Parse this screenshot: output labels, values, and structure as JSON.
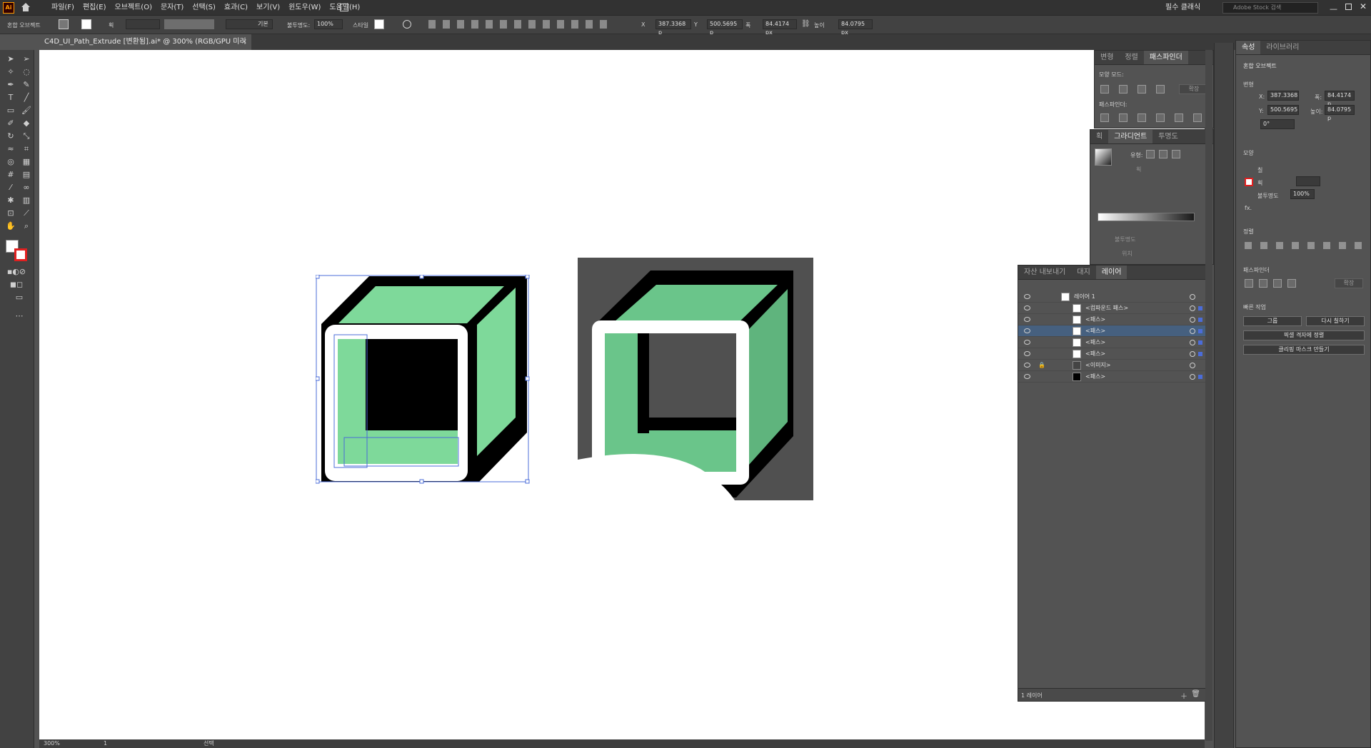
{
  "app": {
    "logo": "Ai",
    "menus": [
      "파일(F)",
      "편집(E)",
      "오브젝트(O)",
      "문자(T)",
      "선택(S)",
      "효과(C)",
      "보기(V)",
      "윈도우(W)",
      "도움말(H)"
    ],
    "workspace": "필수 클래식",
    "search_placeholder": "Adobe Stock 검색"
  },
  "control": {
    "label": "혼합 오브젝트",
    "stroke_label": "획",
    "stroke_style": "기본",
    "opacity_label": "불투명도:",
    "opacity": "100%",
    "style_label": "스타일",
    "x": "387.3368 p",
    "y": "500.5695 p",
    "w": "84.4174 px",
    "h": "84.0795 px",
    "x_label": "X",
    "y_label": "Y",
    "w_label": "폭",
    "h_label": "높이"
  },
  "document": {
    "tab": "C4D_UI_Path_Extrude [변환됨].ai* @ 300% (RGB/GPU 미리 보기)"
  },
  "status": {
    "zoom": "300%",
    "artboard": "1",
    "tool": "선택"
  },
  "pathfinder": {
    "tabs": [
      "변형",
      "정렬",
      "패스파인더"
    ],
    "shape_modes": "모양 모드:",
    "pathfinders": "패스파인더:",
    "expand": "확장"
  },
  "gradient": {
    "tabs": [
      "획",
      "그라디언트",
      "투명도"
    ],
    "type_label": "유형:",
    "stroke_label": "획",
    "opacity_label": "불투명도",
    "location_label": "위치"
  },
  "layers": {
    "tabs": [
      "자산 내보내기",
      "대지",
      "레이어"
    ],
    "layer_name": "레이어 1",
    "items": [
      "<컴파운드 패스>",
      "<패스>",
      "<패스>",
      "<패스>",
      "<패스>",
      "<이미지>",
      "<패스>"
    ],
    "count": "1 레이어"
  },
  "properties": {
    "tabs": [
      "속성",
      "라이브러리"
    ],
    "object": "혼합 오브젝트",
    "transform": "변형",
    "x_label": "X:",
    "x": "387.3368",
    "y_label": "Y:",
    "y": "500.5695",
    "w_label": "폭:",
    "w": "84.4174 p",
    "h_label": "높이:",
    "h": "84.0795 p",
    "angle": "0°",
    "appearance": "모양",
    "fill": "칠",
    "stroke": "획",
    "opacity_label": "불투명도",
    "opacity": "100%",
    "fx": "fx.",
    "align": "정렬",
    "pathfinder": "패스파인더",
    "pathfinder_expand": "확장",
    "quick_actions": "빠른 작업",
    "group": "그룹",
    "recolor": "다시 칠하기",
    "align_pixel": "픽셀 격자에 정렬",
    "clip_mask": "클리핑 마스크 만들기"
  },
  "colors": {
    "green": "#7ed99a",
    "selection": "#4b6cd8",
    "panel": "#535353"
  }
}
